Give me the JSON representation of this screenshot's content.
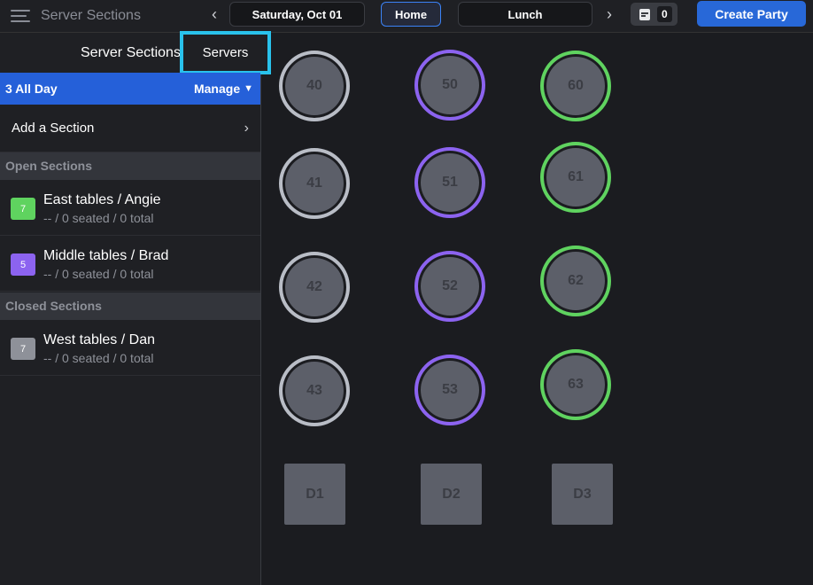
{
  "header": {
    "title": "Server Sections",
    "date": "Saturday, Oct 01",
    "home_label": "Home",
    "shift": "Lunch",
    "badge_count": "0",
    "create_label": "Create Party"
  },
  "sidebar": {
    "title": "Server Sections",
    "servers_tab": "Servers",
    "layout_name": "3 All Day",
    "manage_label": "Manage",
    "add_section_label": "Add a Section",
    "open_header": "Open Sections",
    "closed_header": "Closed Sections",
    "open_sections": [
      {
        "num": "7",
        "name": "East tables / Angie",
        "stats": "-- / 0 seated / 0 total",
        "color": "#5fd35f"
      },
      {
        "num": "5",
        "name": "Middle tables / Brad",
        "stats": "-- / 0 seated / 0 total",
        "color": "#8c63f0"
      }
    ],
    "closed_sections": [
      {
        "num": "7",
        "name": "West tables / Dan",
        "stats": "-- / 0 seated / 0 total",
        "color": "#8e9199"
      }
    ]
  },
  "floor": {
    "tables": [
      "40",
      "41",
      "42",
      "43",
      "50",
      "51",
      "52",
      "53",
      "60",
      "61",
      "62",
      "63",
      "D1",
      "D2",
      "D3"
    ]
  },
  "colors": {
    "accent": "#2868d8",
    "highlight": "#29c2ec",
    "section_green": "#5fd35f",
    "section_purple": "#8c63f0",
    "section_gray": "#b9bdc6"
  }
}
